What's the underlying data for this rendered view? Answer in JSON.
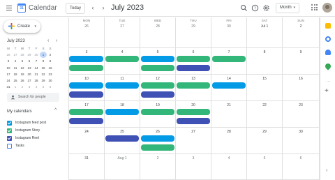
{
  "header": {
    "app_title": "Calendar",
    "logo_text": "31",
    "today_label": "Today",
    "prev_label": "‹",
    "next_label": "›",
    "month_title": "July 2023",
    "view_label": "Month",
    "view_caret": "▾",
    "icons": [
      "search-icon",
      "help-icon",
      "settings-icon",
      "apps-icon",
      "avatar"
    ]
  },
  "sidebar": {
    "create_label": "Create",
    "create_caret": "▾",
    "mini_calendar": {
      "title": "July 2023",
      "prev": "‹",
      "next": "›",
      "weekdays": [
        "M",
        "T",
        "W",
        "T",
        "F",
        "S",
        "S"
      ],
      "weeks": [
        [
          "26",
          "27",
          "28",
          "29",
          "30",
          "1",
          "2"
        ],
        [
          "3",
          "4",
          "5",
          "6",
          "7",
          "8",
          "9"
        ],
        [
          "10",
          "11",
          "12",
          "13",
          "14",
          "15",
          "16"
        ],
        [
          "17",
          "18",
          "19",
          "20",
          "21",
          "22",
          "23"
        ],
        [
          "24",
          "25",
          "26",
          "27",
          "28",
          "29",
          "30"
        ],
        [
          "31",
          "1",
          "2",
          "3",
          "4",
          "5",
          "6"
        ]
      ],
      "selected": "1"
    },
    "search_placeholder": "Search for people",
    "my_calendars_title": "My calendars",
    "my_calendars_caret": "^",
    "calendars": [
      {
        "label": "Instagram feed post",
        "color": "#039be5",
        "checked": true
      },
      {
        "label": "Instagram Story",
        "color": "#33b679",
        "checked": true
      },
      {
        "label": "Instagram Reel",
        "color": "#3f51b5",
        "checked": true
      },
      {
        "label": "Tasks",
        "color": "#4285f4",
        "checked": false
      }
    ]
  },
  "grid": {
    "weekdays": [
      "MON",
      "TUE",
      "WED",
      "THU",
      "FRI",
      "SAT",
      "SUN"
    ],
    "weeks": [
      [
        "26",
        "27",
        "28",
        "29",
        "30",
        "Jul 1",
        "2"
      ],
      [
        "3",
        "4",
        "5",
        "6",
        "7",
        "8",
        "9"
      ],
      [
        "10",
        "11",
        "12",
        "13",
        "14",
        "15",
        "16"
      ],
      [
        "17",
        "18",
        "19",
        "20",
        "21",
        "22",
        "23"
      ],
      [
        "24",
        "25",
        "26",
        "27",
        "28",
        "29",
        "30"
      ],
      [
        "31",
        "Aug 1",
        "2",
        "3",
        "4",
        "5",
        "6"
      ]
    ],
    "muted_cells": [
      [
        0,
        0
      ],
      [
        0,
        1
      ],
      [
        0,
        2
      ],
      [
        0,
        3
      ],
      [
        0,
        4
      ],
      [
        5,
        1
      ],
      [
        5,
        2
      ],
      [
        5,
        3
      ],
      [
        5,
        4
      ],
      [
        5,
        5
      ],
      [
        5,
        6
      ]
    ],
    "events": [
      {
        "week": 1,
        "day": 0,
        "slot": 0,
        "calendar": "Instagram feed post"
      },
      {
        "week": 1,
        "day": 0,
        "slot": 1,
        "calendar": "Instagram Story"
      },
      {
        "week": 1,
        "day": 1,
        "slot": 0,
        "calendar": "Instagram Story"
      },
      {
        "week": 1,
        "day": 2,
        "slot": 0,
        "calendar": "Instagram feed post"
      },
      {
        "week": 1,
        "day": 2,
        "slot": 1,
        "calendar": "Instagram Story"
      },
      {
        "week": 1,
        "day": 3,
        "slot": 0,
        "calendar": "Instagram Story"
      },
      {
        "week": 1,
        "day": 3,
        "slot": 1,
        "calendar": "Instagram Reel"
      },
      {
        "week": 1,
        "day": 4,
        "slot": 0,
        "calendar": "Instagram Story"
      },
      {
        "week": 2,
        "day": 0,
        "slot": 0,
        "calendar": "Instagram feed post"
      },
      {
        "week": 2,
        "day": 0,
        "slot": 1,
        "calendar": "Instagram Reel"
      },
      {
        "week": 2,
        "day": 1,
        "slot": 0,
        "calendar": "Instagram feed post"
      },
      {
        "week": 2,
        "day": 2,
        "slot": 0,
        "calendar": "Instagram Story"
      },
      {
        "week": 2,
        "day": 2,
        "slot": 1,
        "calendar": "Instagram Reel"
      },
      {
        "week": 2,
        "day": 3,
        "slot": 0,
        "calendar": "Instagram Story"
      },
      {
        "week": 2,
        "day": 4,
        "slot": 0,
        "calendar": "Instagram feed post"
      },
      {
        "week": 3,
        "day": 0,
        "slot": 0,
        "calendar": "Instagram Story"
      },
      {
        "week": 3,
        "day": 0,
        "slot": 1,
        "calendar": "Instagram Reel"
      },
      {
        "week": 3,
        "day": 1,
        "slot": 0,
        "calendar": "Instagram feed post"
      },
      {
        "week": 3,
        "day": 2,
        "slot": 0,
        "calendar": "Instagram Story"
      },
      {
        "week": 3,
        "day": 3,
        "slot": 0,
        "calendar": "Instagram Story"
      },
      {
        "week": 3,
        "day": 3,
        "slot": 1,
        "calendar": "Instagram Reel"
      },
      {
        "week": 4,
        "day": 1,
        "slot": 0,
        "calendar": "Instagram Reel"
      },
      {
        "week": 4,
        "day": 2,
        "slot": 0,
        "calendar": "Instagram feed post"
      },
      {
        "week": 4,
        "day": 2,
        "slot": 1,
        "calendar": "Instagram Story"
      }
    ]
  },
  "rail": {
    "icons": [
      "keep-icon",
      "tasks-icon",
      "contacts-icon",
      "maps-icon"
    ],
    "more": "...",
    "add": "+",
    "collapse": "›"
  },
  "colors": {
    "Instagram feed post": "#039be5",
    "Instagram Story": "#33b679",
    "Instagram Reel": "#3f51b5"
  }
}
